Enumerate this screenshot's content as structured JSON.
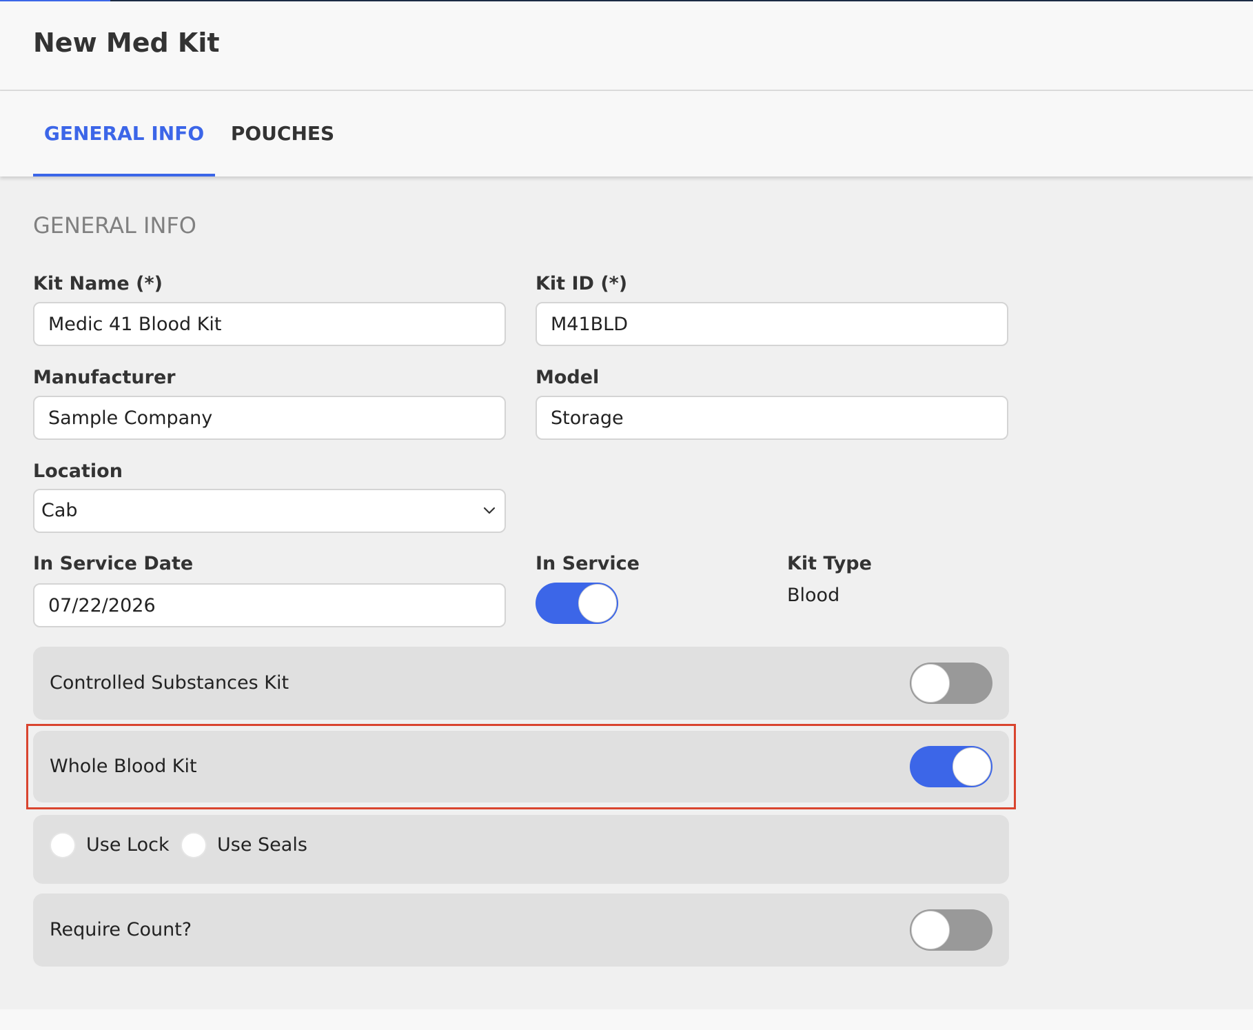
{
  "header": {
    "title": "New Med Kit"
  },
  "tabs": [
    {
      "label": "GENERAL INFO",
      "active": true
    },
    {
      "label": "POUCHES",
      "active": false
    }
  ],
  "section": {
    "heading": "GENERAL INFO"
  },
  "fields": {
    "kit_name": {
      "label": "Kit Name (*)",
      "value": "Medic 41 Blood Kit"
    },
    "kit_id": {
      "label": "Kit ID (*)",
      "value": "M41BLD"
    },
    "manufacturer": {
      "label": "Manufacturer",
      "value": "Sample Company"
    },
    "model": {
      "label": "Model",
      "value": "Storage"
    },
    "location": {
      "label": "Location",
      "value": "Cab"
    },
    "in_service_date": {
      "label": "In Service Date",
      "value": "07/22/2026"
    },
    "in_service": {
      "label": "In Service",
      "on": true
    },
    "kit_type": {
      "label": "Kit Type",
      "value": "Blood"
    }
  },
  "options": {
    "controlled_substances": {
      "label": "Controlled Substances Kit",
      "on": false
    },
    "whole_blood": {
      "label": "Whole Blood Kit",
      "on": true
    },
    "use_lock": {
      "label": "Use Lock",
      "selected": false
    },
    "use_seals": {
      "label": "Use Seals",
      "selected": false
    },
    "require_count": {
      "label": "Require Count?",
      "on": false
    }
  },
  "icons": {
    "select_arrow": "chevron-down-icon"
  },
  "colors": {
    "accent": "#3c66e8",
    "highlight": "#d9442e",
    "toggle_off": "#999999"
  }
}
